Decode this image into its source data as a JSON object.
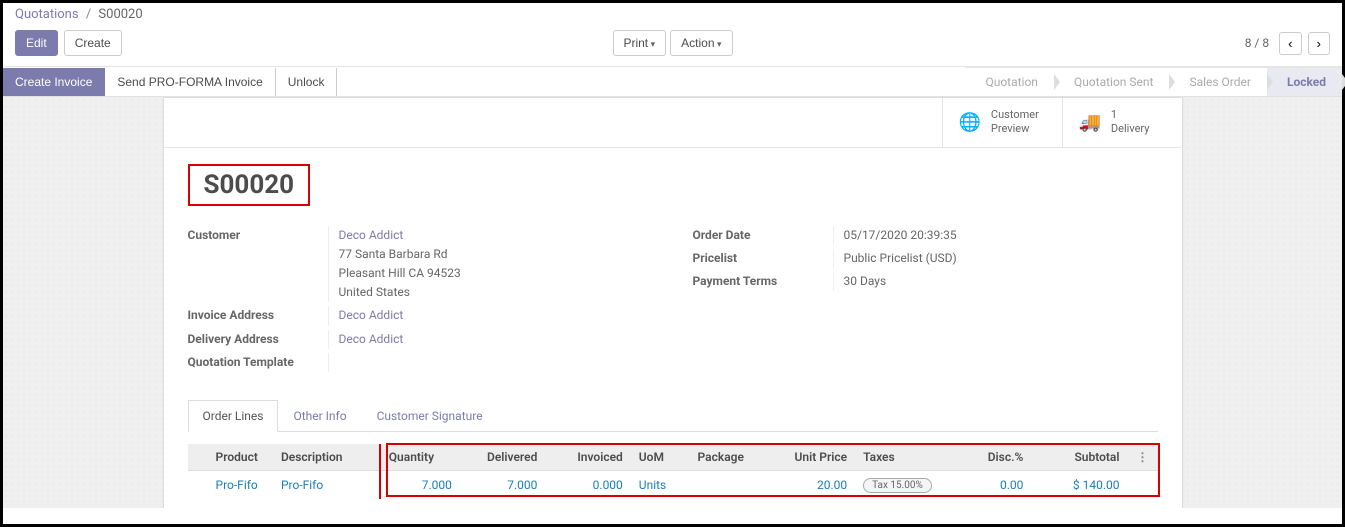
{
  "breadcrumb": {
    "parent": "Quotations",
    "current": "S00020"
  },
  "toolbar": {
    "edit": "Edit",
    "create": "Create",
    "print": "Print",
    "action": "Action",
    "pager": "8 / 8"
  },
  "action_bar": {
    "create_invoice": "Create Invoice",
    "send_proforma": "Send PRO-FORMA Invoice",
    "unlock": "Unlock"
  },
  "status": {
    "s1": "Quotation",
    "s2": "Quotation Sent",
    "s3": "Sales Order",
    "s4": "Locked"
  },
  "stat": {
    "preview_l1": "Customer",
    "preview_l2": "Preview",
    "delivery_l1": "1",
    "delivery_l2": "Delivery"
  },
  "record": {
    "title": "S00020"
  },
  "left_form": {
    "customer_label": "Customer",
    "customer_link": "Deco Addict",
    "addr1": "77 Santa Barbara Rd",
    "addr2": "Pleasant Hill CA 94523",
    "addr3": "United States",
    "invoice_label": "Invoice Address",
    "invoice_link": "Deco Addict",
    "delivery_label": "Delivery Address",
    "delivery_link": "Deco Addict",
    "template_label": "Quotation Template"
  },
  "right_form": {
    "order_date_label": "Order Date",
    "order_date": "05/17/2020 20:39:35",
    "pricelist_label": "Pricelist",
    "pricelist": "Public Pricelist (USD)",
    "terms_label": "Payment Terms",
    "terms": "30 Days"
  },
  "tabs": {
    "lines": "Order Lines",
    "other": "Other Info",
    "sig": "Customer Signature"
  },
  "headers": {
    "product": "Product",
    "description": "Description",
    "quantity": "Quantity",
    "delivered": "Delivered",
    "invoiced": "Invoiced",
    "uom": "UoM",
    "package": "Package",
    "unit_price": "Unit Price",
    "taxes": "Taxes",
    "disc": "Disc.%",
    "subtotal": "Subtotal"
  },
  "row": {
    "product": "Pro-Fifo",
    "description": "Pro-Fifo",
    "quantity": "7.000",
    "delivered": "7.000",
    "invoiced": "0.000",
    "uom": "Units",
    "package": "",
    "unit_price": "20.00",
    "taxes": "Tax 15.00%",
    "disc": "0.00",
    "subtotal": "$ 140.00"
  }
}
